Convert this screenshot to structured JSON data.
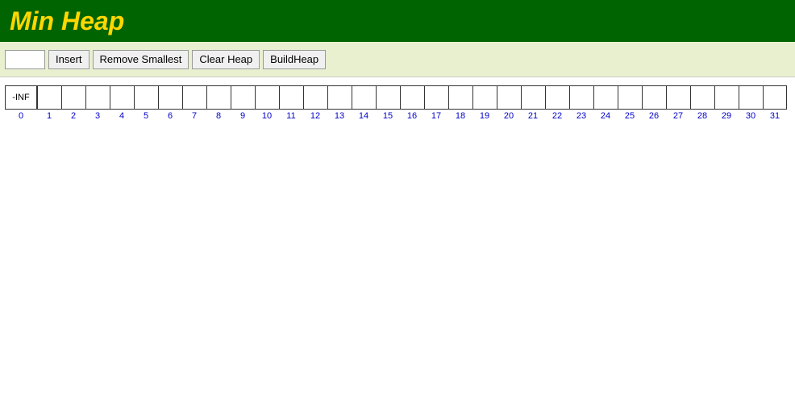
{
  "header": {
    "title": "Min Heap",
    "background": "#006400",
    "title_color": "#FFD700"
  },
  "toolbar": {
    "input_placeholder": "",
    "insert_label": "Insert",
    "remove_smallest_label": "Remove Smallest",
    "clear_heap_label": "Clear Heap",
    "build_heap_label": "BuildHeap"
  },
  "array": {
    "cells": [
      {
        "index": 0,
        "value": "-INF",
        "first": true
      },
      {
        "index": 1,
        "value": ""
      },
      {
        "index": 2,
        "value": ""
      },
      {
        "index": 3,
        "value": ""
      },
      {
        "index": 4,
        "value": ""
      },
      {
        "index": 5,
        "value": ""
      },
      {
        "index": 6,
        "value": ""
      },
      {
        "index": 7,
        "value": ""
      },
      {
        "index": 8,
        "value": ""
      },
      {
        "index": 9,
        "value": ""
      },
      {
        "index": 10,
        "value": ""
      },
      {
        "index": 11,
        "value": ""
      },
      {
        "index": 12,
        "value": ""
      },
      {
        "index": 13,
        "value": ""
      },
      {
        "index": 14,
        "value": ""
      },
      {
        "index": 15,
        "value": ""
      },
      {
        "index": 16,
        "value": ""
      },
      {
        "index": 17,
        "value": ""
      },
      {
        "index": 18,
        "value": ""
      },
      {
        "index": 19,
        "value": ""
      },
      {
        "index": 20,
        "value": ""
      },
      {
        "index": 21,
        "value": ""
      },
      {
        "index": 22,
        "value": ""
      },
      {
        "index": 23,
        "value": ""
      },
      {
        "index": 24,
        "value": ""
      },
      {
        "index": 25,
        "value": ""
      },
      {
        "index": 26,
        "value": ""
      },
      {
        "index": 27,
        "value": ""
      },
      {
        "index": 28,
        "value": ""
      },
      {
        "index": 29,
        "value": ""
      },
      {
        "index": 30,
        "value": ""
      },
      {
        "index": 31,
        "value": ""
      }
    ]
  }
}
